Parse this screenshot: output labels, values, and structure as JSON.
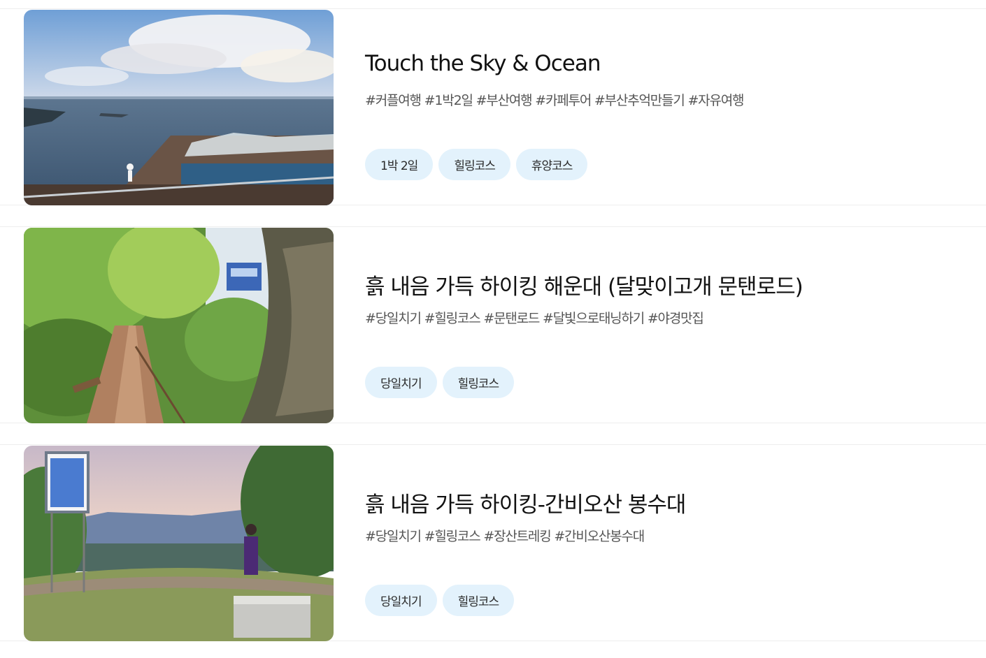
{
  "courses": [
    {
      "title": "Touch the Sky & Ocean",
      "hashtags": "#커플여행 #1박2일 #부산여행 #카페투어 #부산추억만들기 #자유여행",
      "chips": [
        "1박 2일",
        "힐링코스",
        "휴양코스"
      ]
    },
    {
      "title": "흙 내음 가득 하이킹 해운대 (달맞이고개 문탠로드)",
      "hashtags": "#당일치기 #힐링코스 #문탠로드 #달빛으로태닝하기 #야경맛집",
      "chips": [
        "당일치기",
        "힐링코스"
      ]
    },
    {
      "title": "흙 내음 가득 하이킹-간비오산 봉수대",
      "hashtags": "#당일치기 #힐링코스 #장산트레킹 #간비오산봉수대",
      "chips": [
        "당일치기",
        "힐링코스"
      ]
    }
  ]
}
